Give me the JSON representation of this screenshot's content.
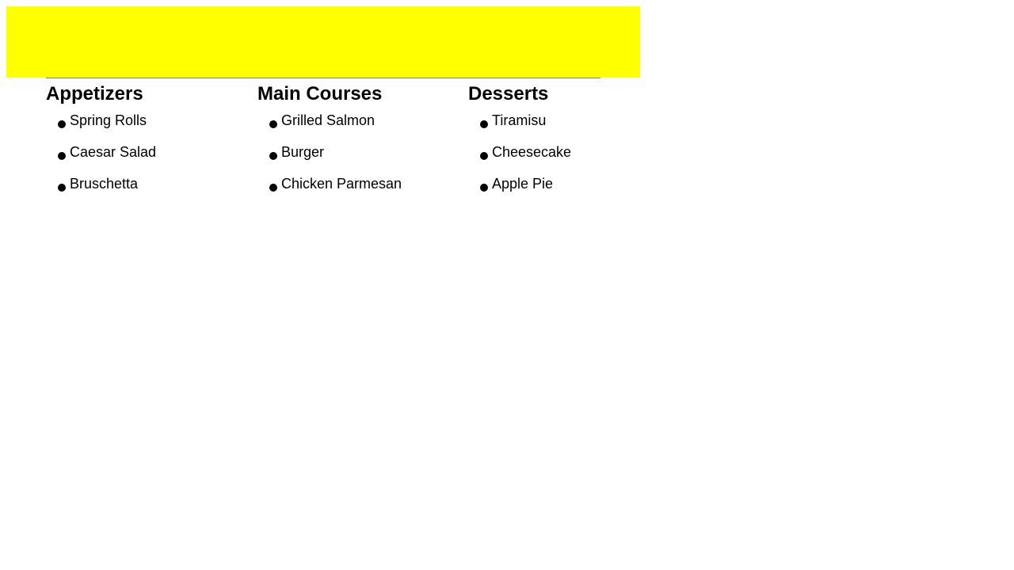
{
  "colors": {
    "banner": "#ffff00",
    "divider": "#808080",
    "text": "#000000"
  },
  "menu": {
    "sections": [
      {
        "heading": "Appetizers",
        "items": [
          "Spring Rolls",
          "Caesar Salad",
          "Bruschetta"
        ]
      },
      {
        "heading": "Main Courses",
        "items": [
          "Grilled Salmon",
          "Burger",
          "Chicken Parmesan"
        ]
      },
      {
        "heading": "Desserts",
        "items": [
          "Tiramisu",
          "Cheesecake",
          "Apple Pie"
        ]
      }
    ]
  }
}
